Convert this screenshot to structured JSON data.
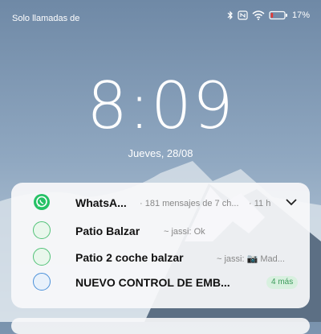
{
  "status_bar": {
    "carrier": "Solo llamadas de",
    "battery_percent": "17",
    "battery_level": 0.17,
    "battery_color": "#e53935",
    "icons": [
      "bluetooth-icon",
      "nfc-icon",
      "wifi-icon",
      "battery-icon"
    ]
  },
  "lock": {
    "time": "8:09",
    "date": "Jueves, 28/08"
  },
  "notifications": {
    "header": {
      "app": "WhatsA...",
      "summary": "· 181 mensajes de 7 ch...",
      "time": "· 11 h",
      "icon": "whatsapp-icon",
      "accent": "#25c165"
    },
    "items": [
      {
        "title": "Patio Balzar",
        "preview": "~ jassi: Ok",
        "badge": ""
      },
      {
        "title": "Patio 2 coche balzar",
        "preview": "~ jassi: 📷 Mad...",
        "badge": ""
      },
      {
        "title": "NUEVO CONTROL DE EMB...",
        "preview": "",
        "badge": "4 más"
      }
    ]
  }
}
